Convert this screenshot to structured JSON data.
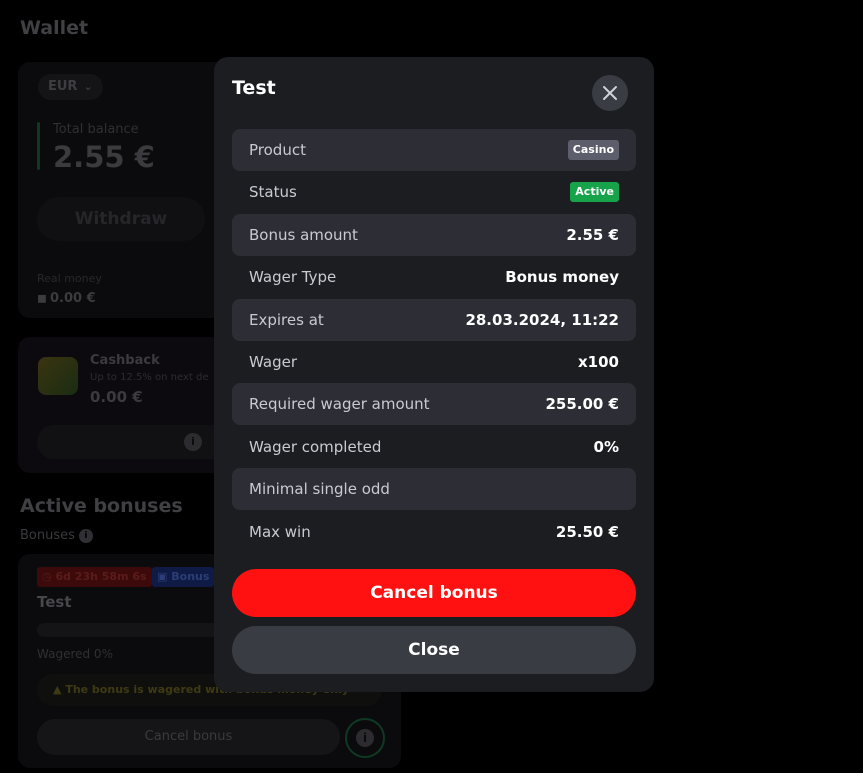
{
  "page": {
    "title": "Wallet",
    "currency": "EUR",
    "total_balance_label": "Total balance",
    "total_balance_value": "2.55 €",
    "withdraw_label": "Withdraw",
    "real_money_label": "Real money",
    "real_money_value": "0.00 €",
    "cashback": {
      "title": "Cashback",
      "subtitle": "Up to 12.5% on next de",
      "value": "0.00 €"
    },
    "active_bonuses_title": "Active bonuses",
    "bonuses_label": "Bonuses",
    "bonus_card": {
      "timer": "6d 23h 58m 6s",
      "type_badge": "Bonus",
      "name": "Test",
      "wagered": "Wagered 0%",
      "warning": "The bonus is wagered with bonus money only",
      "cancel_label": "Cancel bonus"
    }
  },
  "modal": {
    "title": "Test",
    "rows": [
      {
        "label": "Product",
        "badge": "Casino"
      },
      {
        "label": "Status",
        "badge": "Active"
      },
      {
        "label": "Bonus amount",
        "value": "2.55 €"
      },
      {
        "label": "Wager Type",
        "value": "Bonus money"
      },
      {
        "label": "Expires at",
        "value": "28.03.2024, 11:22"
      },
      {
        "label": "Wager",
        "value": "x100"
      },
      {
        "label": "Required wager amount",
        "value": "255.00 €"
      },
      {
        "label": "Wager completed",
        "value": "0%"
      },
      {
        "label": "Minimal single odd",
        "value": ""
      },
      {
        "label": "Max win",
        "value": "25.50 €"
      }
    ],
    "cancel_button": "Cancel bonus",
    "close_button": "Close"
  },
  "colors": {
    "modal_bg": "#1c1d21",
    "row_shade": "#2c2d35",
    "cancel_red": "#ff1111",
    "active_green": "#16a34a"
  }
}
